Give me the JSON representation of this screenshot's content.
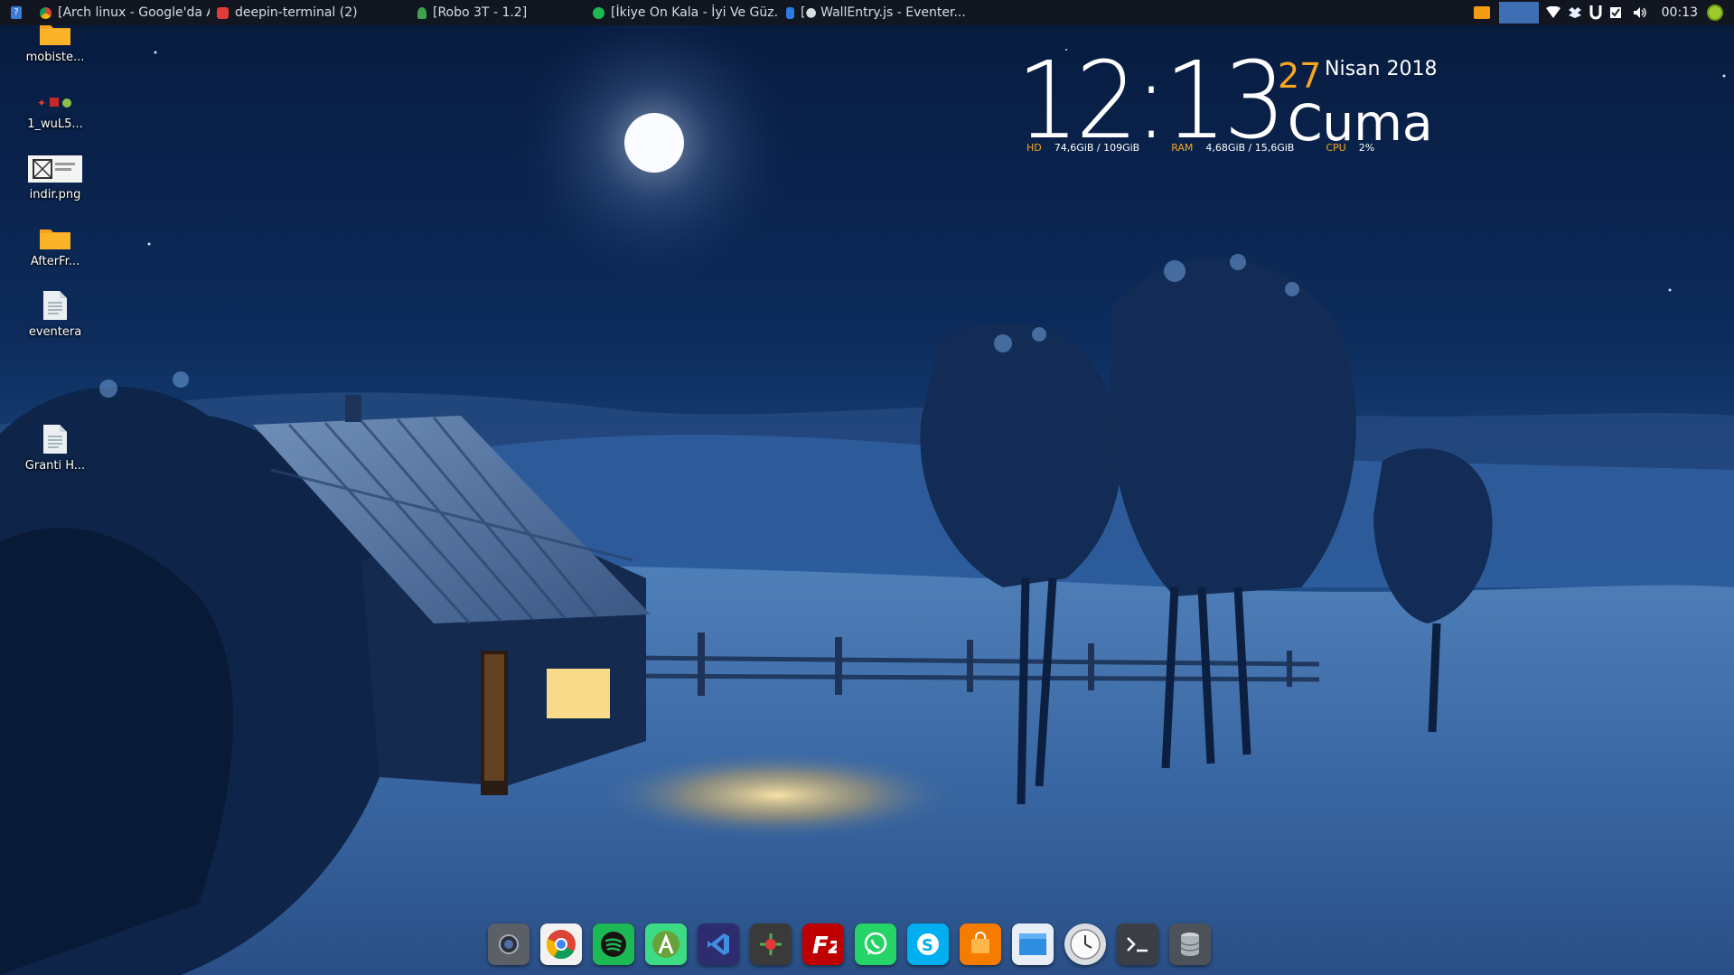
{
  "top_panel": {
    "launcher_icon": "panel-menu-icon",
    "windows": [
      {
        "label": "[Arch linux - Google'da Ar...",
        "icon": "chrome-icon",
        "color": "#db4437"
      },
      {
        "label": "deepin-terminal (2)",
        "icon": "terminal-icon",
        "color": "#e33b3b"
      },
      {
        "label": "[Robo 3T - 1.2]",
        "icon": "robo3t-icon",
        "color": "#3fa34d"
      },
      {
        "label": "[İkiye On Kala - İyi Ve Güz...",
        "icon": "spotify-icon",
        "color": "#1db954"
      },
      {
        "label": "[● WallEntry.js - Eventer...",
        "icon": "vscode-icon",
        "color": "#2d7be5"
      }
    ],
    "tray": {
      "clock": "00:13",
      "icons": [
        "screenshot-tray-icon",
        "workspace-indicator",
        "wifi-icon",
        "dropbox-icon",
        "magnet-icon",
        "checkbox-icon",
        "volume-icon",
        "update-icon"
      ]
    }
  },
  "desktop": {
    "icons": [
      {
        "label": "mobiste...",
        "icon": "folder-icon"
      },
      {
        "label": "1_wuL5...",
        "icon": "image-file-icon"
      },
      {
        "label": "indir.png",
        "icon": "image-file-icon"
      },
      {
        "label": "AfterFr...",
        "icon": "folder-icon"
      },
      {
        "label": "eventera",
        "icon": "text-file-icon"
      },
      {
        "label": "Granti H...",
        "icon": "text-file-icon"
      }
    ]
  },
  "conky": {
    "time": "12:13",
    "day": "27",
    "month_year": "Nisan 2018",
    "weekday": "Cuma",
    "hd_label": "HD",
    "hd_value": "74,6GiB / 109GiB",
    "ram_label": "RAM",
    "ram_value": "4,68GiB / 15,6GiB",
    "cpu_label": "CPU",
    "cpu_value": "2%",
    "accent_color": "#f5a623"
  },
  "dock": {
    "items": [
      {
        "name": "screenshot-app",
        "icon": "camera-icon"
      },
      {
        "name": "google-chrome",
        "icon": "chrome-icon"
      },
      {
        "name": "spotify",
        "icon": "spotify-icon"
      },
      {
        "name": "android-studio",
        "icon": "android-studio-icon"
      },
      {
        "name": "visual-studio-code",
        "icon": "vscode-icon"
      },
      {
        "name": "robo-3t",
        "icon": "robo3t-icon"
      },
      {
        "name": "filezilla",
        "icon": "filezilla-icon"
      },
      {
        "name": "whatsapp",
        "icon": "whatsapp-icon"
      },
      {
        "name": "skype",
        "icon": "skype-icon"
      },
      {
        "name": "app-store",
        "icon": "store-icon"
      },
      {
        "name": "file-manager",
        "icon": "file-manager-icon"
      },
      {
        "name": "clock",
        "icon": "clock-icon"
      },
      {
        "name": "terminal",
        "icon": "terminal-icon"
      },
      {
        "name": "database",
        "icon": "database-icon"
      }
    ]
  }
}
